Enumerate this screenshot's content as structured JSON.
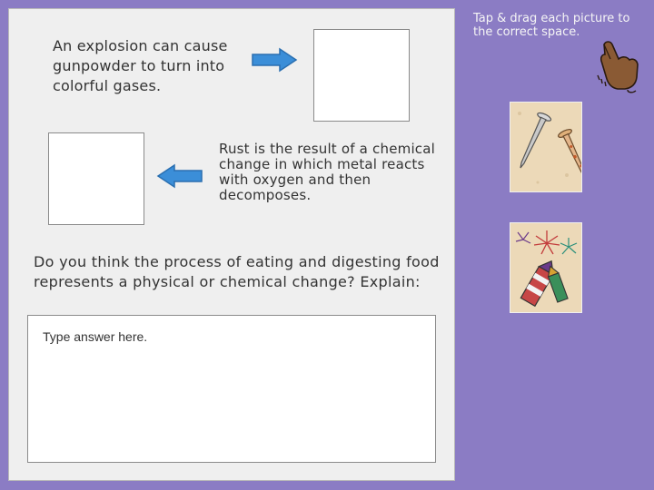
{
  "worksheet": {
    "prompt1": "An explosion can cause gunpowder to turn into colorful gases.",
    "prompt2": "Rust is the result of a chemical change in which metal reacts with oxygen and then decomposes.",
    "question": "Do you think the process of eating and digesting food represents a physical or chemical change? Explain:",
    "answer_placeholder": "Type answer here."
  },
  "side": {
    "instruction": "Tap & drag each picture to the correct space."
  },
  "icons": {
    "arrow_right": "arrow-right-icon",
    "arrow_left": "arrow-left-icon",
    "hand": "pointing-hand-icon"
  },
  "colors": {
    "background": "#8b7cc4",
    "panel": "#efefef",
    "arrow": "#3b8ed8"
  }
}
